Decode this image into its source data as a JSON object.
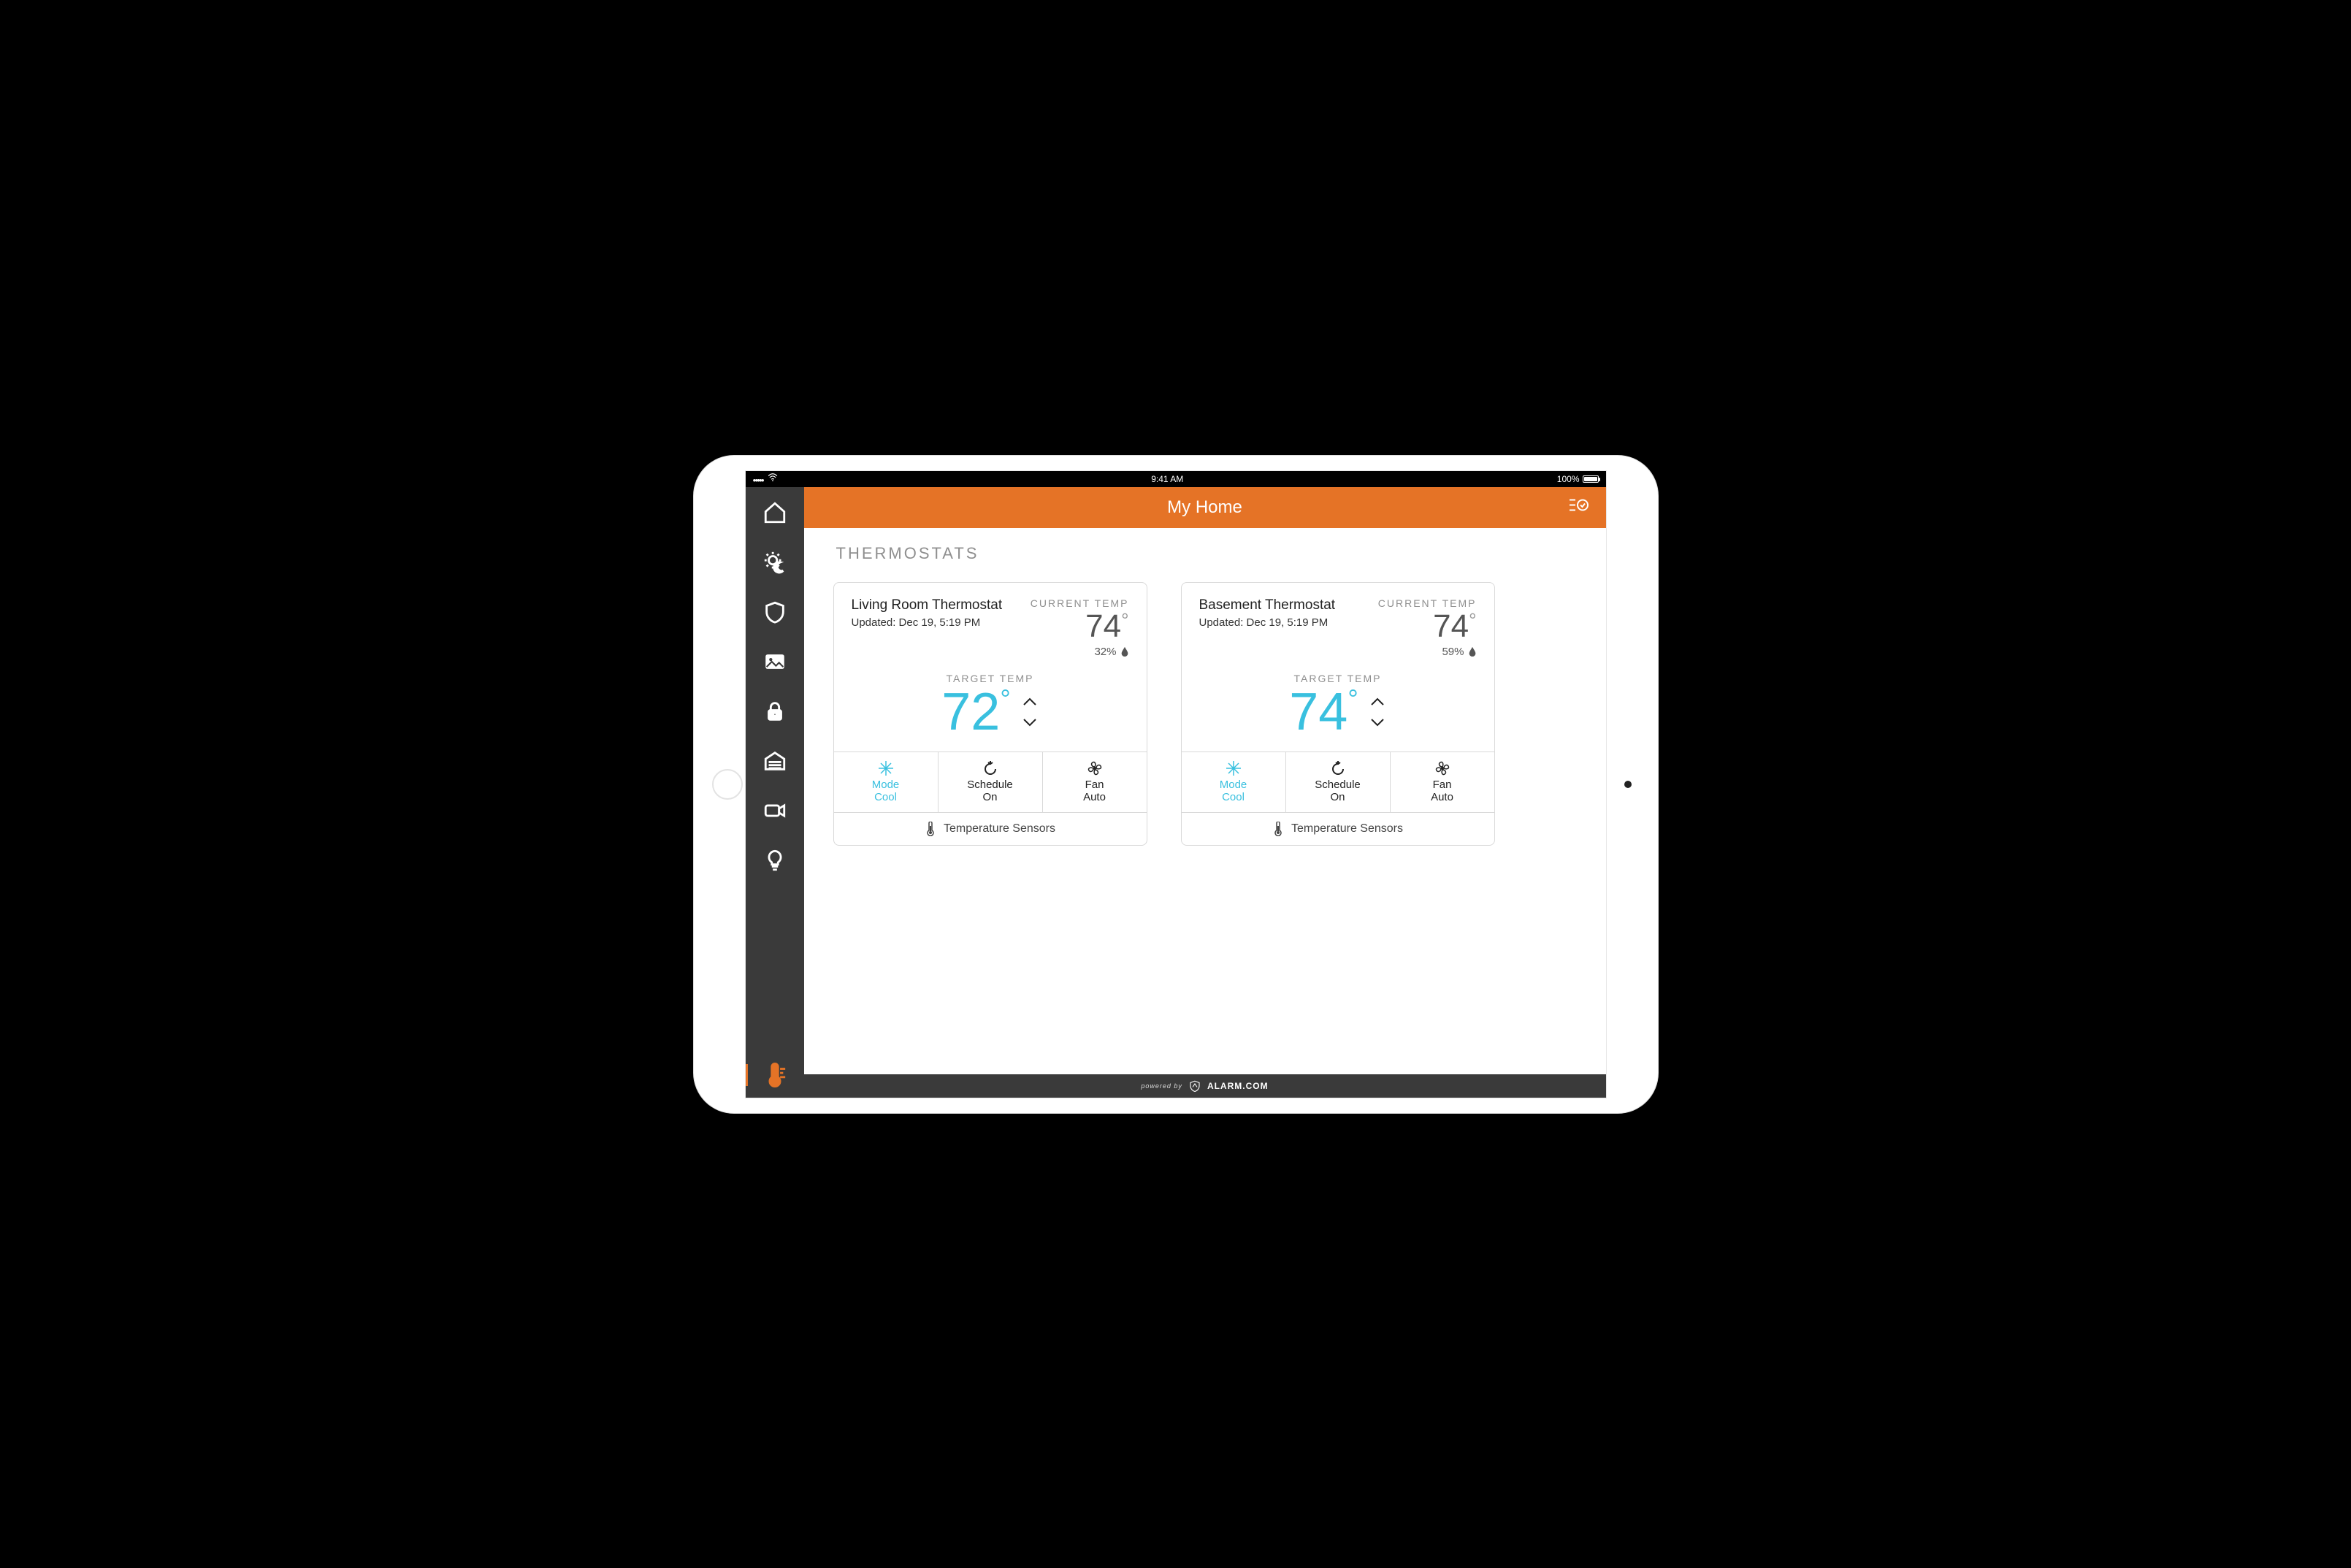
{
  "statusbar": {
    "time": "9:41 AM",
    "battery_label": "100%"
  },
  "titlebar": {
    "title": "My Home"
  },
  "section": {
    "heading": "THERMOSTATS"
  },
  "labels": {
    "current_temp": "CURRENT TEMP",
    "target_temp": "TARGET TEMP",
    "mode": "Mode",
    "schedule": "Schedule",
    "fan": "Fan",
    "sensors": "Temperature Sensors"
  },
  "thermostats": [
    {
      "name": "Living Room Thermostat",
      "updated": "Updated: Dec 19, 5:19 PM",
      "current_temp": "74",
      "humidity": "32%",
      "target_temp": "72",
      "mode_value": "Cool",
      "schedule_value": "On",
      "fan_value": "Auto"
    },
    {
      "name": "Basement Thermostat",
      "updated": "Updated: Dec 19, 5:19 PM",
      "current_temp": "74",
      "humidity": "59%",
      "target_temp": "74",
      "mode_value": "Cool",
      "schedule_value": "On",
      "fan_value": "Auto"
    }
  ],
  "footer": {
    "powered_by": "powered by",
    "brand": "ALARM.COM"
  },
  "sidebar": {
    "items": [
      {
        "name": "home"
      },
      {
        "name": "scenes"
      },
      {
        "name": "security"
      },
      {
        "name": "images"
      },
      {
        "name": "locks"
      },
      {
        "name": "garage"
      },
      {
        "name": "video"
      },
      {
        "name": "lights"
      },
      {
        "name": "thermostats",
        "active": true
      }
    ]
  }
}
